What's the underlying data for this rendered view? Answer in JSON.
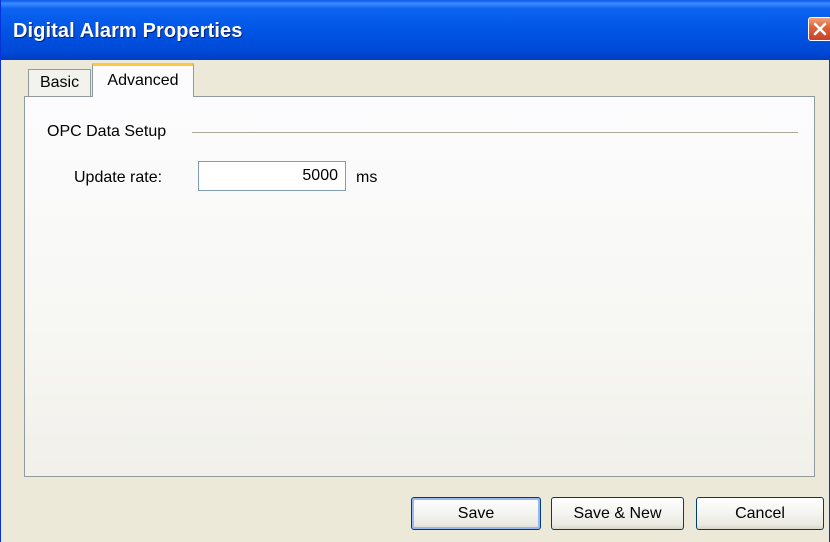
{
  "window": {
    "title": "Digital Alarm Properties"
  },
  "tabs": [
    {
      "label": "Basic",
      "selected": false
    },
    {
      "label": "Advanced",
      "selected": true
    }
  ],
  "advanced": {
    "group_label": "OPC Data Setup",
    "update_rate_label": "Update rate:",
    "update_rate_value": "5000",
    "update_rate_unit": "ms"
  },
  "buttons": {
    "save": "Save",
    "save_new": "Save & New",
    "cancel": "Cancel"
  },
  "colors": {
    "titlebar": "#0055e5",
    "close_button": "#e0643a",
    "active_tab_accent": "#ffc73c",
    "dialog_background": "#ece9d8"
  }
}
